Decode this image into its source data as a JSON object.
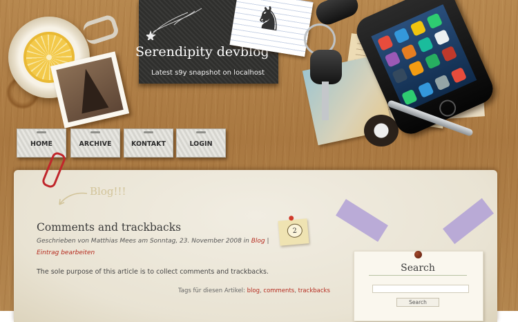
{
  "site": {
    "title": "Serendipity devblog",
    "subtitle": "Latest s9y snapshot on localhost"
  },
  "nav": {
    "items": [
      {
        "label": "HOME"
      },
      {
        "label": "ARCHIVE"
      },
      {
        "label": "KONTAKT"
      },
      {
        "label": "LOGIN"
      }
    ]
  },
  "decor": {
    "blog_doodle": "Blog!!!"
  },
  "entry": {
    "title": "Comments and trackbacks",
    "meta_prefix": "Geschrieben von Matthias Mees am Sonntag, 23. November 2008 in",
    "category": "Blog",
    "meta_separator": "|",
    "edit_link": "Eintrag bearbeiten",
    "body": "The sole purpose of this article is to collect comments and trackbacks.",
    "comment_count": "2",
    "tags_label": "Tags für diesen Artikel:",
    "tags": [
      "blog",
      "comments",
      "trackbacks"
    ]
  },
  "sidebar": {
    "search": {
      "title": "Search",
      "input_value": "",
      "button_label": "Search"
    }
  },
  "colors": {
    "link": "#b52a1e",
    "paper": "#ede8db",
    "desk": "#a97841"
  }
}
